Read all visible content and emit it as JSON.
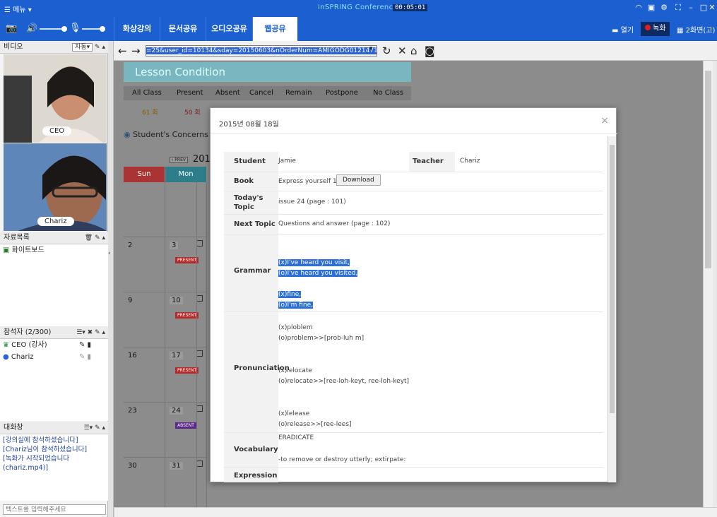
{
  "titlebar": {
    "menu_label": "☰ 메뉴 ▾",
    "app_title": "InSPRING Conference",
    "timer": "00:05:01"
  },
  "tabs": [
    {
      "label": "화상강의"
    },
    {
      "label": "문서공유"
    },
    {
      "label": "오디오공유"
    },
    {
      "label": "웹공유",
      "active": true
    }
  ],
  "top_buttons": {
    "open": "열기",
    "record": "녹화",
    "screen_mode": "2화면(고)"
  },
  "video_panel": {
    "title": "비디오",
    "mode": "자동▾",
    "participants": [
      "CEO",
      "Chariz"
    ]
  },
  "materials_panel": {
    "title": "자료목록",
    "items": [
      "화이트보드"
    ]
  },
  "attendees_panel": {
    "title": "참석자 (2/300)",
    "items": [
      "CEO (강사)",
      "Chariz"
    ]
  },
  "chat_panel": {
    "title": "대화창",
    "messages": [
      "[강의실에 참석하셨습니다]",
      "[Chariz님이 참석하셨습니다]",
      "[녹화가 시작되었습니다",
      "(chariz.mp4)]"
    ],
    "input_placeholder": "텍스트를 입력해주세요"
  },
  "browser": {
    "url": "=25&user_id=10134&sday=20150603&nOrderNum=AMIGODG01214718&sp=6"
  },
  "lesson_page": {
    "title": "Lesson Condition",
    "class_headers": [
      "All Class",
      "Present",
      "Absent",
      "Cancel",
      "Remain",
      "Postpone",
      "No Class"
    ],
    "class_values": [
      "61 회",
      "50 회"
    ],
    "concerns": "Student's Concerns",
    "prev": "‹ PREV",
    "year": "201",
    "days": [
      "Sun",
      "Mon"
    ],
    "weeks": [
      {
        "sun": "2",
        "mon": "3",
        "badge": "PRESENT"
      },
      {
        "sun": "9",
        "mon": "10",
        "badge": "PRESENT"
      },
      {
        "sun": "16",
        "mon": "17",
        "badge": "PRESENT"
      },
      {
        "sun": "23",
        "mon": "24",
        "badge": "ABSENT"
      },
      {
        "sun": "30",
        "mon": "31",
        "badge": ""
      }
    ]
  },
  "modal": {
    "title": "2015년 08월 18일",
    "close": "×",
    "student_label": "Student",
    "student": "Jamie",
    "teacher_label": "Teacher",
    "teacher": "Chariz",
    "book_label": "Book",
    "book": "Express yourself 1",
    "download": "Download",
    "topic_label_1": "Today's",
    "topic_label_2": "Topic",
    "topic": "issue 24 (page : 101)",
    "next_label": "Next Topic",
    "next": "Questions and answer (page : 102)",
    "grammar_label": "Grammar",
    "grammar": [
      "(x)I've heard you visit,",
      "(o)I've heard you visited,",
      "(x)fine,",
      "(o)I'm fine,"
    ],
    "pron_label": "Pronunciation",
    "pron": [
      "(x)plobl​em",
      "(o)problem>>[prob-luh m]",
      "(x)lelocate",
      "(o)relocate>>[ree-loh-keyt, ree-loh-keyt]",
      "(x)lelease",
      "(o)release>>[ree-lees]"
    ],
    "vocab_label": "Vocabulary",
    "vocab": [
      "ERADICATE",
      "-to remove or destroy utterly; extirpate:"
    ],
    "expr_label": "Expression"
  },
  "colors": {
    "brand_blue": "#1b5fd0",
    "teal": "#7ab6bf",
    "highlight": "#2b6fd8"
  }
}
